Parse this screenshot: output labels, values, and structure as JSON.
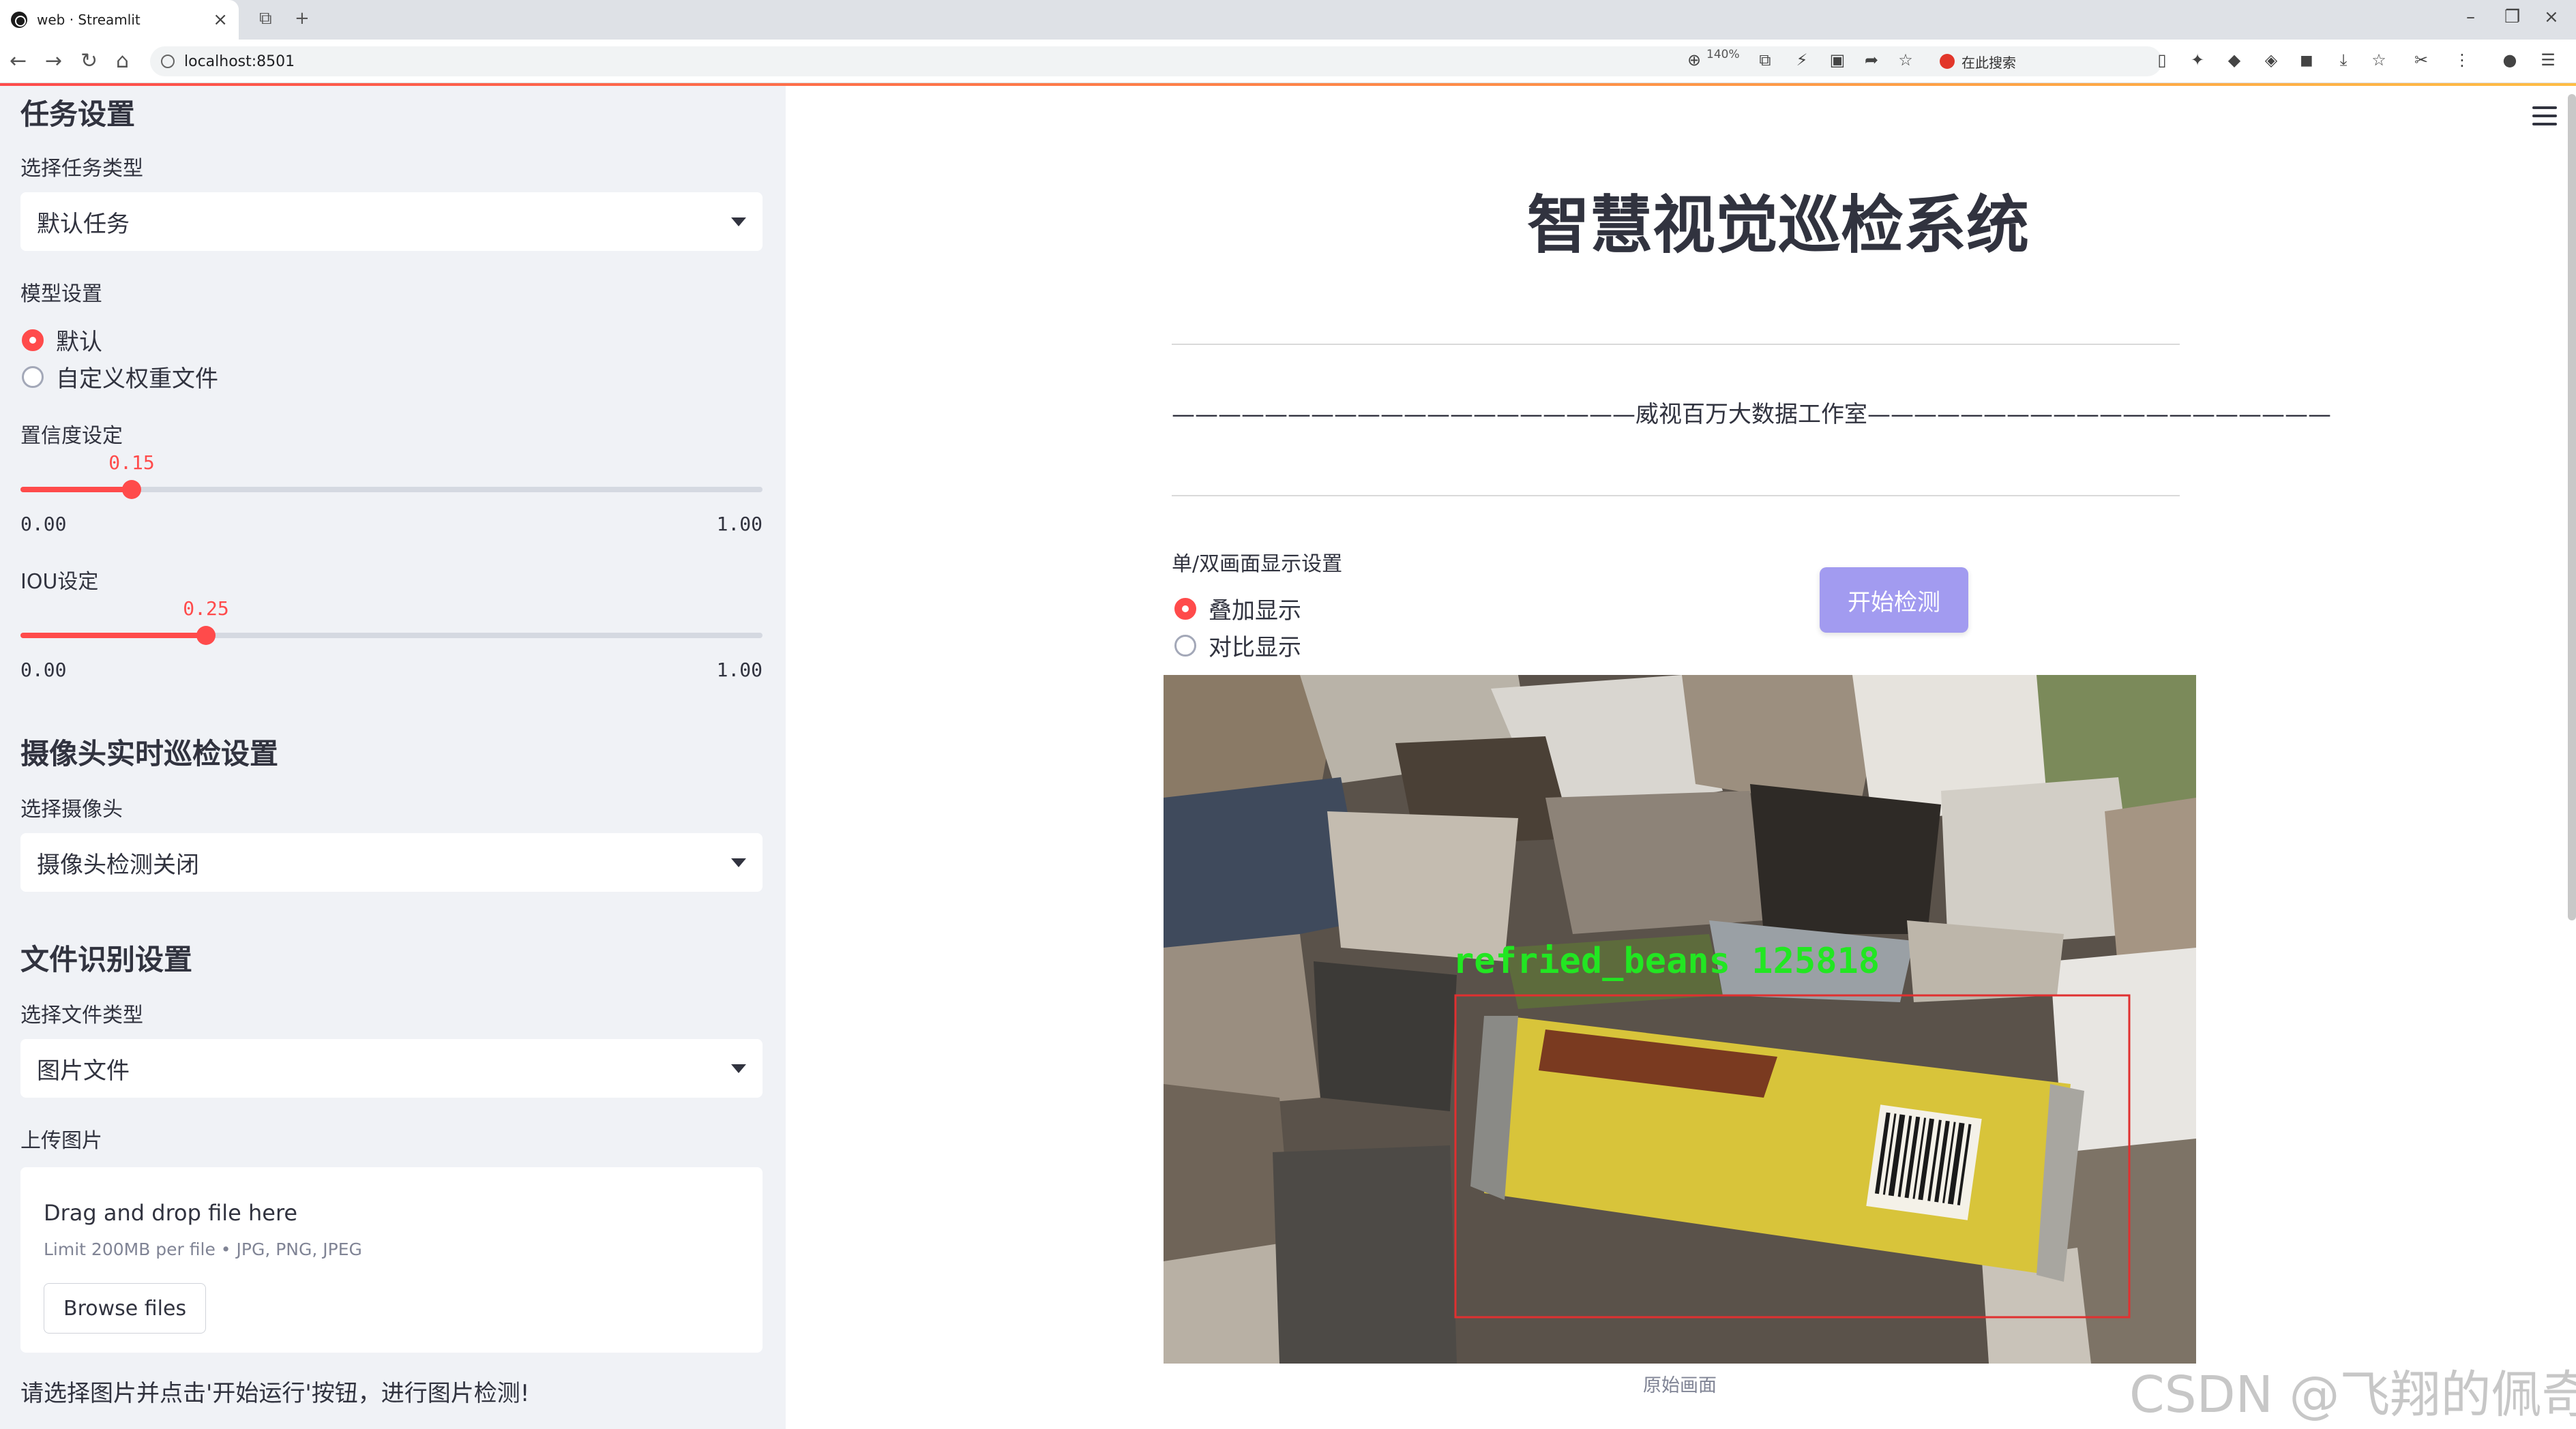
{
  "browser": {
    "tab_title": "web · Streamlit",
    "url": "localhost:8501",
    "zoom": "140%",
    "search_placeholder": "在此搜索"
  },
  "sidebar": {
    "task_section_title": "任务设置",
    "task_type_label": "选择任务类型",
    "task_type_value": "默认任务",
    "model_label": "模型设置",
    "model_options": [
      "默认",
      "自定义权重文件"
    ],
    "model_selected": 0,
    "conf_label": "置信度设定",
    "conf_value": 0.15,
    "conf_value_text": "0.15",
    "conf_min": "0.00",
    "conf_max": "1.00",
    "iou_label": "IOU设定",
    "iou_value": 0.25,
    "iou_value_text": "0.25",
    "iou_min": "0.00",
    "iou_max": "1.00",
    "camera_section_title": "摄像头实时巡检设置",
    "camera_label": "选择摄像头",
    "camera_value": "摄像头检测关闭",
    "file_section_title": "文件识别设置",
    "file_type_label": "选择文件类型",
    "file_type_value": "图片文件",
    "upload_label": "上传图片",
    "upload_title": "Drag and drop file here",
    "upload_limit": "Limit 200MB per file • JPG, PNG, JPEG",
    "browse_label": "Browse files",
    "hint": "请选择图片并点击'开始运行'按钮，进行图片检测!"
  },
  "main": {
    "title": "智慧视觉巡检系统",
    "studio_line": "————————————————————威视百万大数据工作室————————————————————",
    "display_label": "单/双画面显示设置",
    "display_options": [
      "叠加显示",
      "对比显示"
    ],
    "display_selected": 0,
    "start_button": "开始检测",
    "detection_label": "refried_beans 125818",
    "image_caption": "原始画面",
    "watermark": "CSDN @飞翔的佩奇"
  },
  "colors": {
    "accent": "#ff4b4b",
    "sidebar_bg": "#f0f2f6",
    "primary_button": "#a29bf0",
    "detection_box": "#e03030",
    "detection_text": "#22e622"
  }
}
